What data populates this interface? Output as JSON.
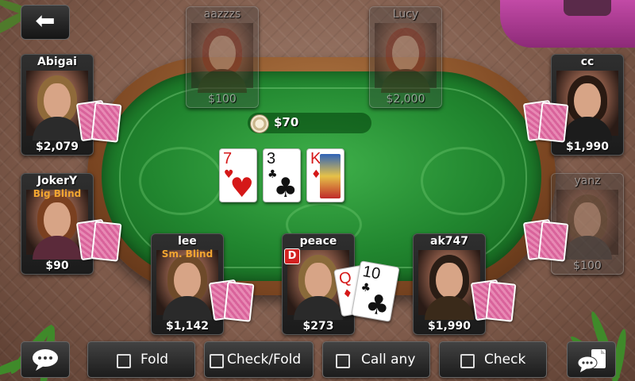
{
  "navigation": {
    "back_icon": "back-arrow-icon"
  },
  "pot": {
    "amount": "$70"
  },
  "community_cards": [
    {
      "rank": "7",
      "suit": "♥",
      "color": "red"
    },
    {
      "rank": "3",
      "suit": "♣",
      "color": "black"
    },
    {
      "rank": "K",
      "suit": "♦",
      "color": "red"
    }
  ],
  "players": [
    {
      "name": "aazzzs",
      "chips": "$100",
      "empty": true
    },
    {
      "name": "Lucy",
      "chips": "$2,000",
      "empty": true
    },
    {
      "name": "Abigai",
      "chips": "$2,079"
    },
    {
      "name": "cc",
      "chips": "$1,990"
    },
    {
      "name": "JokerY",
      "role": "Big Blind",
      "chips": "$90"
    },
    {
      "name": "yanz",
      "chips": "$100",
      "empty": true
    },
    {
      "name": "lee",
      "role": "Sm. Blind",
      "chips": "$1,142"
    },
    {
      "name": "peace",
      "chips": "$273",
      "dealer": "D"
    },
    {
      "name": "ak747",
      "chips": "$1,990"
    }
  ],
  "hole_cards": [
    {
      "rank": "Q",
      "suit": "♦",
      "color": "red"
    },
    {
      "rank": "10",
      "suit": "♣",
      "color": "black"
    }
  ],
  "actions": {
    "fold": "Fold",
    "check_fold": "Check/Fold",
    "call_any": "Call any",
    "check": "Check"
  },
  "icons": {
    "chat": "chat-bubble-icon",
    "menu": "chat-menu-icon"
  }
}
